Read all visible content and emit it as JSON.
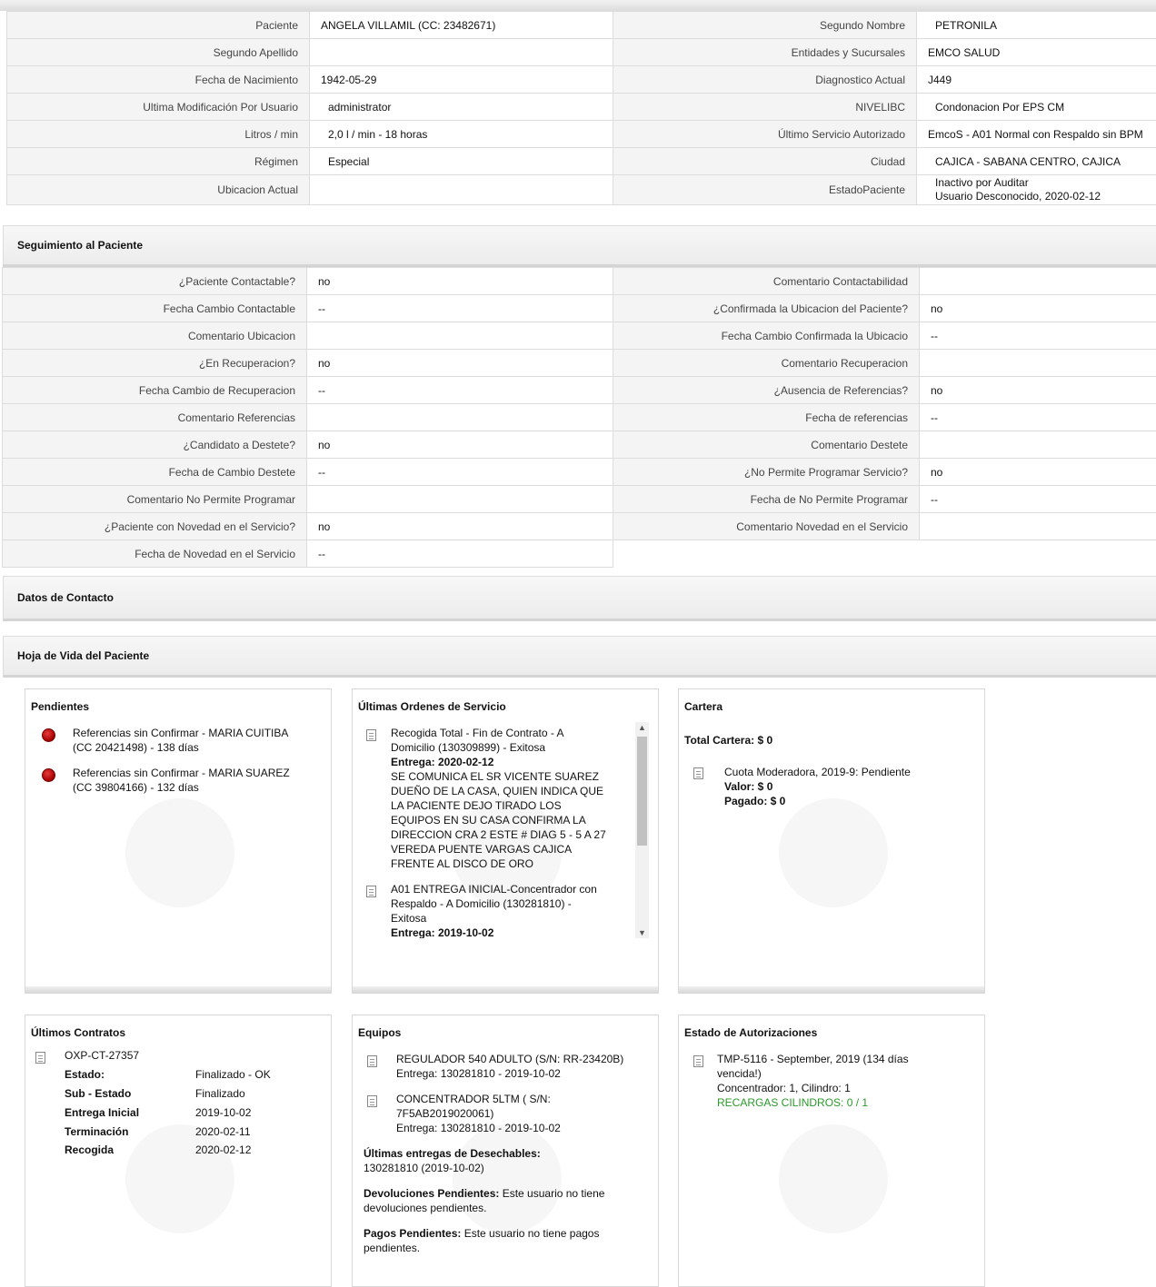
{
  "patient_info": {
    "rows": [
      {
        "l1": "Paciente",
        "v1": "ANGELA VILLAMIL (CC: 23482671)",
        "l2": "Segundo Nombre",
        "v2": "PETRONILA"
      },
      {
        "l1": "Segundo Apellido",
        "v1": "",
        "l2": "Entidades y Sucursales",
        "v2": "EMCO SALUD"
      },
      {
        "l1": "Fecha de Nacimiento",
        "v1": "1942-05-29",
        "l2": "Diagnostico Actual",
        "v2": "J449"
      },
      {
        "l1": "Ultima Modificación Por Usuario",
        "v1": "administrator",
        "l2": "NIVELIBC",
        "v2": "Condonacion Por EPS CM"
      },
      {
        "l1": "Litros / min",
        "v1": "2,0 l / min - 18 horas",
        "l2": "Último Servicio Autorizado",
        "v2": "EmcoS - A01 Normal con Respaldo sin BPM"
      },
      {
        "l1": "Régimen",
        "v1": "Especial",
        "l2": "Ciudad",
        "v2": "CAJICA - SABANA CENTRO, CAJICA"
      },
      {
        "l1": "Ubicacion Actual",
        "v1": "",
        "l2": "EstadoPaciente",
        "v2a": "Inactivo por Auditar",
        "v2b": "Usuario Desconocido, 2020-02-12"
      }
    ]
  },
  "seguimiento": {
    "title": "Seguimiento al Paciente",
    "rows": [
      {
        "l1": "¿Paciente Contactable?",
        "v1": "no",
        "l2": "Comentario Contactabilidad",
        "v2": ""
      },
      {
        "l1": "Fecha Cambio Contactable",
        "v1": "--",
        "l2": "¿Confirmada la Ubicacion del Paciente?",
        "v2": "no"
      },
      {
        "l1": "Comentario Ubicacion",
        "v1": "",
        "l2": "Fecha Cambio Confirmada la Ubicacio",
        "v2": "--"
      },
      {
        "l1": "¿En Recuperacion?",
        "v1": "no",
        "l2": "Comentario Recuperacion",
        "v2": ""
      },
      {
        "l1": "Fecha Cambio de Recuperacion",
        "v1": "--",
        "l2": "¿Ausencia de Referencias?",
        "v2": "no"
      },
      {
        "l1": "Comentario Referencias",
        "v1": "",
        "l2": "Fecha de referencias",
        "v2": "--"
      },
      {
        "l1": "¿Candidato a Destete?",
        "v1": "no",
        "l2": "Comentario Destete",
        "v2": ""
      },
      {
        "l1": "Fecha de Cambio Destete",
        "v1": "--",
        "l2": "¿No Permite Programar Servicio?",
        "v2": "no"
      },
      {
        "l1": "Comentario No Permite Programar",
        "v1": "",
        "l2": "Fecha de No Permite Programar",
        "v2": "--"
      },
      {
        "l1": "¿Paciente con Novedad en el Servicio?",
        "v1": "no",
        "l2": "Comentario Novedad en el Servicio",
        "v2": ""
      },
      {
        "l1": "Fecha de Novedad en el Servicio",
        "v1": "--"
      }
    ]
  },
  "datos_contacto": {
    "title": "Datos de Contacto"
  },
  "hoja_vida": {
    "title": "Hoja de Vida del Paciente"
  },
  "pendientes": {
    "title": "Pendientes",
    "items": [
      {
        "line1": "Referencias sin Confirmar - MARIA CUITIBA",
        "line2": "(CC 20421498) - 138 días"
      },
      {
        "line1": "Referencias sin Confirmar - MARIA SUAREZ",
        "line2": "(CC 39804166) - 132 días"
      }
    ]
  },
  "ordenes": {
    "title": "Últimas Ordenes de Servicio",
    "o1_l1": "Recogida Total - Fin de Contrato - A",
    "o1_l2": "Domicilio (130309899) - Exitosa",
    "o1_entrega": "Entrega: 2020-02-12",
    "o1_note": [
      "SE COMUNICA EL SR VICENTE SUAREZ",
      "DUEÑO DE LA CASA, QUIEN INDICA QUE",
      "LA PACIENTE DEJO TIRADO LOS",
      "EQUIPOS EN SU CASA CONFIRMA LA",
      "DIRECCION CRA 2 ESTE # DIAG 5 - 5 A 27",
      "VEREDA PUENTE VARGAS CAJICA",
      "FRENTE AL DISCO DE ORO"
    ],
    "o2_l1": "A01 ENTREGA INICIAL-Concentrador con",
    "o2_l2": "Respaldo - A Domicilio (130281810) -",
    "o2_l3": "Exitosa",
    "o2_entrega": "Entrega: 2019-10-02"
  },
  "cartera": {
    "title": "Cartera",
    "total": "Total Cartera: $ 0",
    "item": "Cuota Moderadora, 2019-9: Pendiente",
    "valor": "Valor: $ 0",
    "pagado": "Pagado: $ 0"
  },
  "contratos": {
    "title": "Últimos Contratos",
    "code": "OXP-CT-27357",
    "fields": [
      {
        "k": "Estado:",
        "v": "Finalizado - OK"
      },
      {
        "k": "Sub - Estado",
        "v": "Finalizado"
      },
      {
        "k": "Entrega Inicial",
        "v": "2019-10-02"
      },
      {
        "k": "Terminación",
        "v": "2020-02-11"
      },
      {
        "k": "Recogida",
        "v": "2020-02-12"
      }
    ]
  },
  "equipos": {
    "title": "Equipos",
    "e1_l1": "REGULADOR 540 ADULTO (S/N: RR-23420B)",
    "e1_l2": "Entrega: 130281810 - 2019-10-02",
    "e2_l1": "CONCENTRADOR 5LTM ( S/N:",
    "e2_l2": "7F5AB2019020061)",
    "e2_l3": "Entrega: 130281810 - 2019-10-02",
    "desechables_label": "Últimas entregas de Desechables:",
    "desechables_value": "130281810 (2019-10-02)",
    "devoluciones_label": "Devoluciones Pendientes:",
    "devoluciones_l1": " Este usuario no tiene",
    "devoluciones_l2": "devoluciones pendientes.",
    "pagos_label": "Pagos Pendientes:",
    "pagos_l1": " Este usuario no tiene pagos",
    "pagos_l2": "pendientes."
  },
  "autorizaciones": {
    "title": "Estado de Autorizaciones",
    "l1": "TMP-5116 - September, 2019 (134 días",
    "l2": "vencida!)",
    "l3": "Concentrador: 1, Cilindro: 1",
    "l4": "RECARGAS CILINDROS: 0 / 1"
  }
}
